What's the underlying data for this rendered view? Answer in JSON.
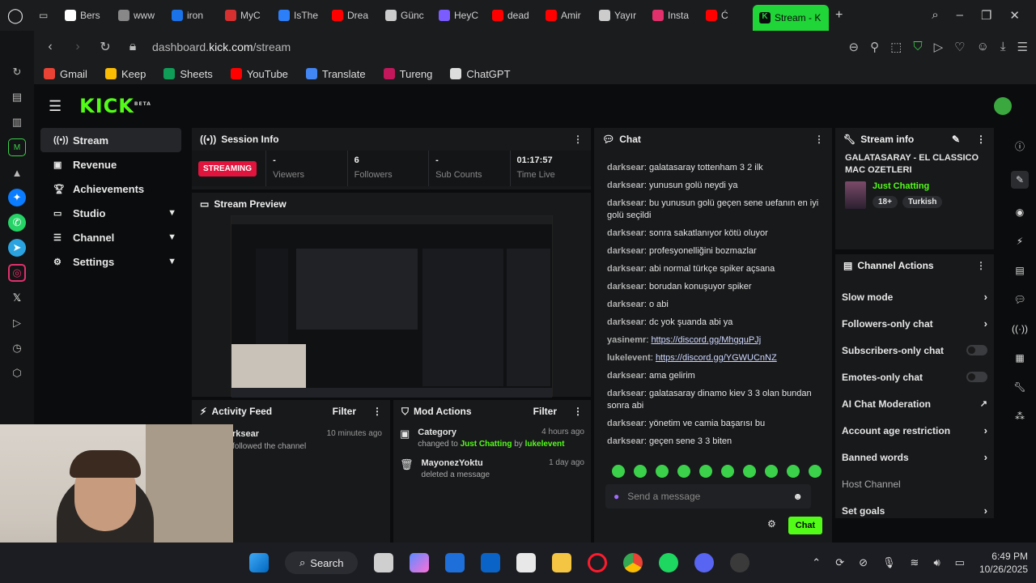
{
  "browser": {
    "tabs": [
      {
        "label": "Bers",
        "color": "#ffffff"
      },
      {
        "label": "www",
        "color": "#888888"
      },
      {
        "label": "iron",
        "color": "#1a73e8"
      },
      {
        "label": "MyC",
        "color": "#d63031"
      },
      {
        "label": "IsThe",
        "color": "#2d7ff9"
      },
      {
        "label": "Drea",
        "color": "#ff0000"
      },
      {
        "label": "Günc",
        "color": "#cccccc"
      },
      {
        "label": "HeyC",
        "color": "#7b5cff"
      },
      {
        "label": "dead",
        "color": "#ff0000"
      },
      {
        "label": "Amir",
        "color": "#ff0000"
      },
      {
        "label": "Yayır",
        "color": "#cccccc"
      },
      {
        "label": "Insta",
        "color": "#e1306c"
      },
      {
        "label": "Ć",
        "color": "#ff0000"
      }
    ],
    "active_tab": "Stream - K",
    "url_prefix": "dashboard.",
    "url_domain": "kick.com",
    "url_path": "/stream",
    "bookmarks": [
      {
        "label": "Gmail",
        "color": "#ea4335"
      },
      {
        "label": "Keep",
        "color": "#fbbc04"
      },
      {
        "label": "Sheets",
        "color": "#0f9d58"
      },
      {
        "label": "YouTube",
        "color": "#ff0000"
      },
      {
        "label": "Translate",
        "color": "#4285f4"
      },
      {
        "label": "Tureng",
        "color": "#c2185b"
      },
      {
        "label": "ChatGPT",
        "color": "#dddddd"
      }
    ]
  },
  "kick": {
    "logo": "KICK",
    "logo_tag": "BETA",
    "nav": [
      {
        "label": "Stream",
        "icon": "broadcast-icon",
        "expand": false
      },
      {
        "label": "Revenue",
        "icon": "wallet-icon",
        "expand": false
      },
      {
        "label": "Achievements",
        "icon": "trophy-icon",
        "expand": false
      },
      {
        "label": "Studio",
        "icon": "monitor-icon",
        "expand": true
      },
      {
        "label": "Channel",
        "icon": "menu-icon",
        "expand": true
      },
      {
        "label": "Settings",
        "icon": "gear-icon",
        "expand": true
      }
    ]
  },
  "session": {
    "title": "Session Info",
    "status": "STREAMING",
    "stats": [
      {
        "value": "-",
        "label": "Viewers"
      },
      {
        "value": "6",
        "label": "Followers"
      },
      {
        "value": "-",
        "label": "Sub Counts"
      },
      {
        "value": "01:17:57",
        "label": "Time Live"
      }
    ]
  },
  "preview": {
    "title": "Stream Preview"
  },
  "activity": {
    "title": "Activity Feed",
    "filter": "Filter",
    "items": [
      {
        "user": "rksear",
        "text": "followed the channel",
        "time": "10 minutes ago"
      }
    ]
  },
  "mod": {
    "title": "Mod Actions",
    "filter": "Filter",
    "items": [
      {
        "title": "Category",
        "pre": "changed to ",
        "highlight": "Just Chatting",
        "mid": " by ",
        "user": "lukelevent",
        "time": "4 hours ago"
      },
      {
        "title": "MayonezYoktu",
        "pre": "deleted a message",
        "highlight": "",
        "mid": "",
        "user": "",
        "time": "1 day ago"
      }
    ]
  },
  "chat": {
    "title": "Chat",
    "messages": [
      {
        "user": "darksear",
        "text": "galatasaray tottenham 3 2 ilk",
        "link": ""
      },
      {
        "user": "darksear",
        "text": "yunusun golü neydi ya",
        "link": ""
      },
      {
        "user": "darksear",
        "text": "bu yunusun golü geçen sene uefanın en iyi golü seçildi",
        "link": ""
      },
      {
        "user": "darksear",
        "text": "sonra sakatlanıyor kötü oluyor",
        "link": ""
      },
      {
        "user": "darksear",
        "text": "profesyonelliğini bozmazlar",
        "link": ""
      },
      {
        "user": "darksear",
        "text": "abi normal türkçe spiker açsana",
        "link": ""
      },
      {
        "user": "darksear",
        "text": "borudan konuşuyor spiker",
        "link": ""
      },
      {
        "user": "darksear",
        "text": "o abi",
        "link": ""
      },
      {
        "user": "darksear",
        "text": "dc yok şuanda abi ya",
        "link": ""
      },
      {
        "user": "yasinemr",
        "text": "",
        "link": "https://discord.gg/MhgquPJj"
      },
      {
        "user": "lukelevent",
        "text": "",
        "link": "https://discord.gg/YGWUCnNZ"
      },
      {
        "user": "darksear",
        "text": "ama gelirim",
        "link": ""
      },
      {
        "user": "darksear",
        "text": "galatasaray dinamo kiev 3 3 olan bundan sonra abi",
        "link": ""
      },
      {
        "user": "darksear",
        "text": "yönetim ve camia başarısı bu",
        "link": ""
      },
      {
        "user": "darksear",
        "text": "geçen sene 3 3 biten",
        "link": ""
      }
    ],
    "placeholder": "Send a message",
    "send_label": "Chat"
  },
  "stream_info": {
    "title": "Stream info",
    "stream_title": "GALATASARAY - EL CLASSICO MAC OZETLERI",
    "category": "Just Chatting",
    "tags": [
      "18+",
      "Turkish"
    ]
  },
  "channel_actions": {
    "title": "Channel Actions",
    "items": [
      {
        "label": "Slow mode",
        "kind": "chevron"
      },
      {
        "label": "Followers-only chat",
        "kind": "chevron"
      },
      {
        "label": "Subscribers-only chat",
        "kind": "toggle"
      },
      {
        "label": "Emotes-only chat",
        "kind": "toggle"
      },
      {
        "label": "AI Chat Moderation",
        "kind": "external"
      },
      {
        "label": "Account age restriction",
        "kind": "chevron"
      },
      {
        "label": "Banned words",
        "kind": "chevron"
      },
      {
        "label": "Host Channel",
        "kind": "none"
      },
      {
        "label": "Set goals",
        "kind": "chevron"
      }
    ]
  },
  "taskbar": {
    "search": "Search",
    "time": "6:49 PM",
    "date": "10/26/2025"
  }
}
